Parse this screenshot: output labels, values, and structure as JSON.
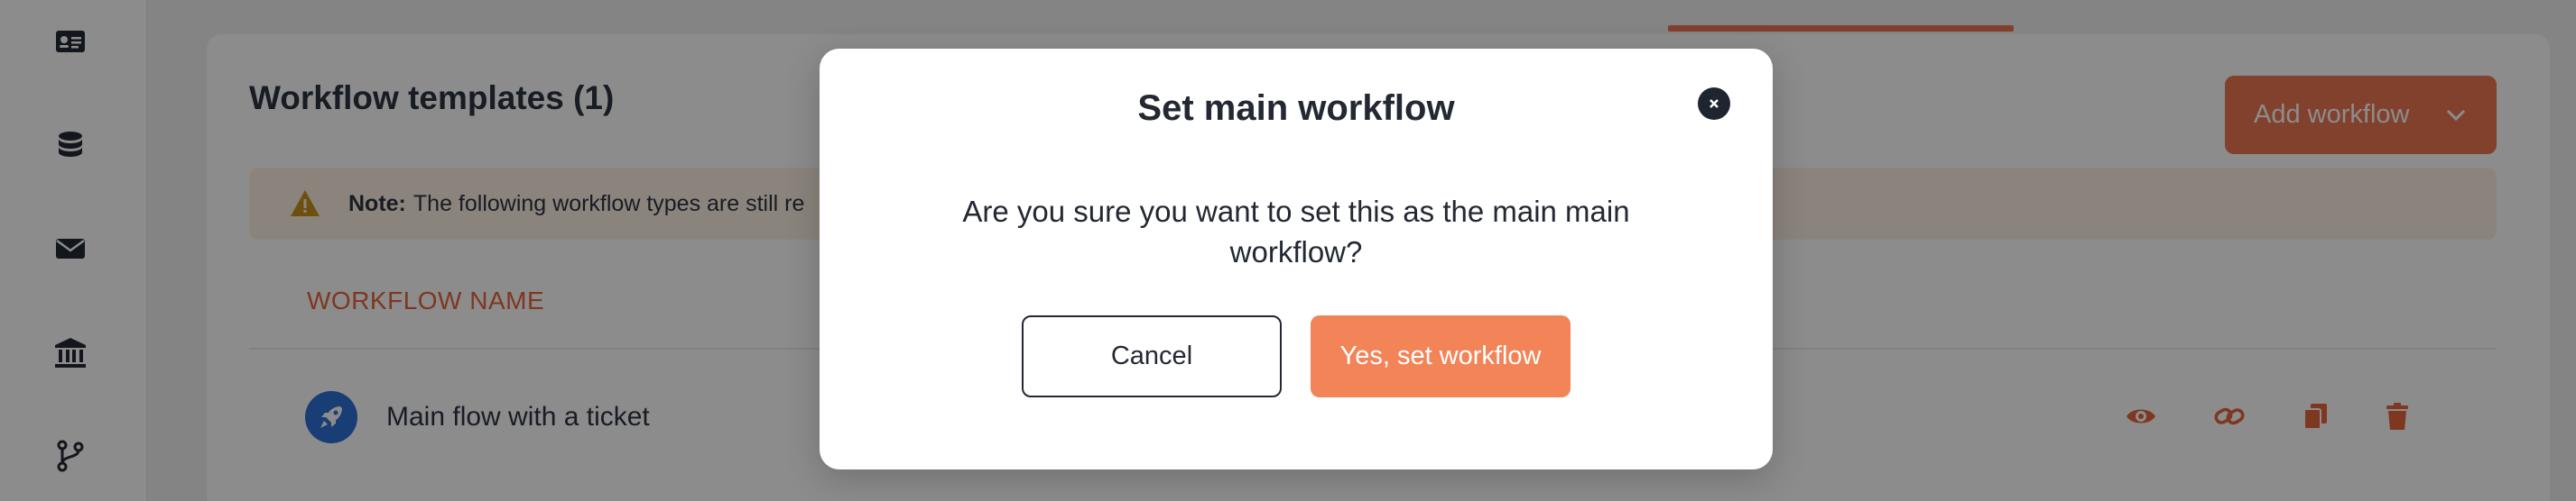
{
  "sidebar": {
    "items": [
      {
        "icon": "id-card-icon"
      },
      {
        "icon": "database-icon"
      },
      {
        "icon": "envelope-icon"
      },
      {
        "icon": "bank-icon"
      },
      {
        "icon": "git-branch-icon"
      }
    ]
  },
  "card": {
    "title": "Workflow templates (1)",
    "add_button_label": "Add workflow",
    "note_label": "Note:",
    "note_text": "The following workflow types are still re",
    "column_header": "WORKFLOW NAME",
    "rows": [
      {
        "name": "Main flow with a ticket",
        "icon": "rocket-icon"
      }
    ],
    "row_actions": [
      "eye-icon",
      "link-icon",
      "copy-icon",
      "trash-icon"
    ]
  },
  "modal": {
    "title": "Set main workflow",
    "message": "Are you sure you want to set this as the main main workflow?",
    "cancel_label": "Cancel",
    "confirm_label": "Yes, set workflow"
  },
  "colors": {
    "accent": "#ed7753",
    "confirm": "#f28458",
    "row_icon_bg": "#2f6fd6",
    "note_bg": "#fdf0e4"
  }
}
